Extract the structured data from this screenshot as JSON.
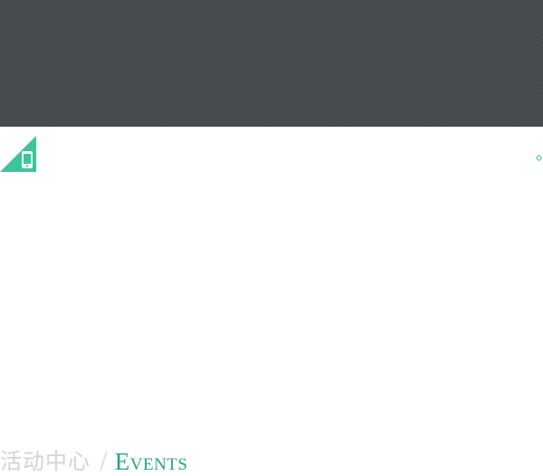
{
  "hero": {
    "background_color": "#44494d"
  },
  "mobile_corner": {
    "icon": "mobile-phone-icon",
    "accent_color": "#3cc49a"
  },
  "marker": {
    "icon": "diamond-icon",
    "color": "#3cc49a"
  },
  "section_heading": {
    "cn_text": "活动中心",
    "separator": "/",
    "en_text": "Events",
    "cn_color": "#d3d3d3",
    "en_color": "#2aa183"
  }
}
